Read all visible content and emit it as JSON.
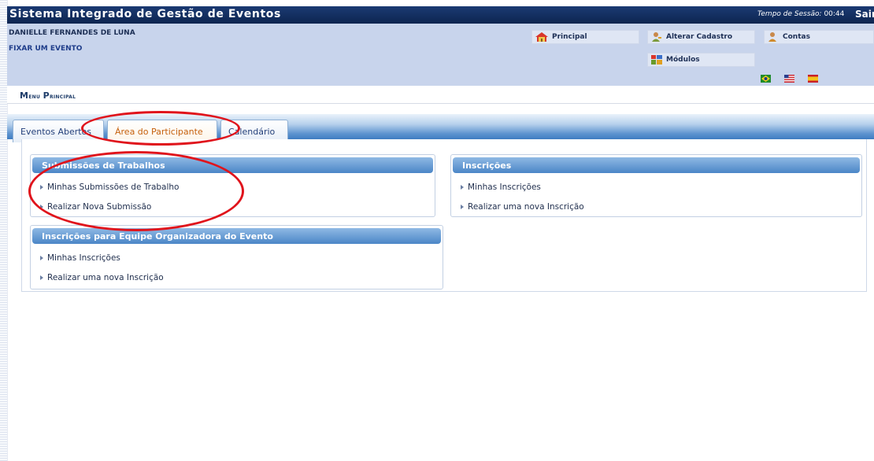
{
  "header": {
    "system_title": "Sistema Integrado de Gestão de Eventos",
    "session_label": "Tempo de Sessão:",
    "session_time": "00:44",
    "logout_label": "Sair"
  },
  "user": {
    "name": "DANIELLE FERNANDES DE LUNA",
    "fix_event": "FIXAR UM EVENTO"
  },
  "quick_links": {
    "principal": "Principal",
    "alterar_cadastro": "Alterar Cadastro",
    "contas": "Contas",
    "modulos": "Módulos"
  },
  "flags": [
    "brazil-flag-icon",
    "usa-flag-icon",
    "spain-flag-icon"
  ],
  "menu": {
    "title_cap1": "M",
    "title_rest1": "enu",
    "title_cap2": "P",
    "title_rest2": "rincipal"
  },
  "tabs": [
    {
      "label": "Eventos Abertos"
    },
    {
      "label": "Área do Participante",
      "active": true
    },
    {
      "label": "Calendário"
    }
  ],
  "panels": {
    "submissoes": {
      "title": "Submissões de Trabalhos",
      "links": [
        "Minhas Submissões de Trabalho",
        "Realizar Nova Submissão"
      ]
    },
    "inscricoes": {
      "title": "Inscrições",
      "links": [
        "Minhas Inscrições",
        "Realizar uma nova Inscrição"
      ]
    },
    "equipe": {
      "title": "Inscrições para Equipe Organizadora do Evento",
      "links": [
        "Minhas Inscrições",
        "Realizar uma nova Inscrição"
      ]
    }
  },
  "colors": {
    "header_bg": "#0d2550",
    "info_bg": "#c8d4ec",
    "active_tab_text": "#c6600c",
    "annotation": "#e0141c"
  }
}
